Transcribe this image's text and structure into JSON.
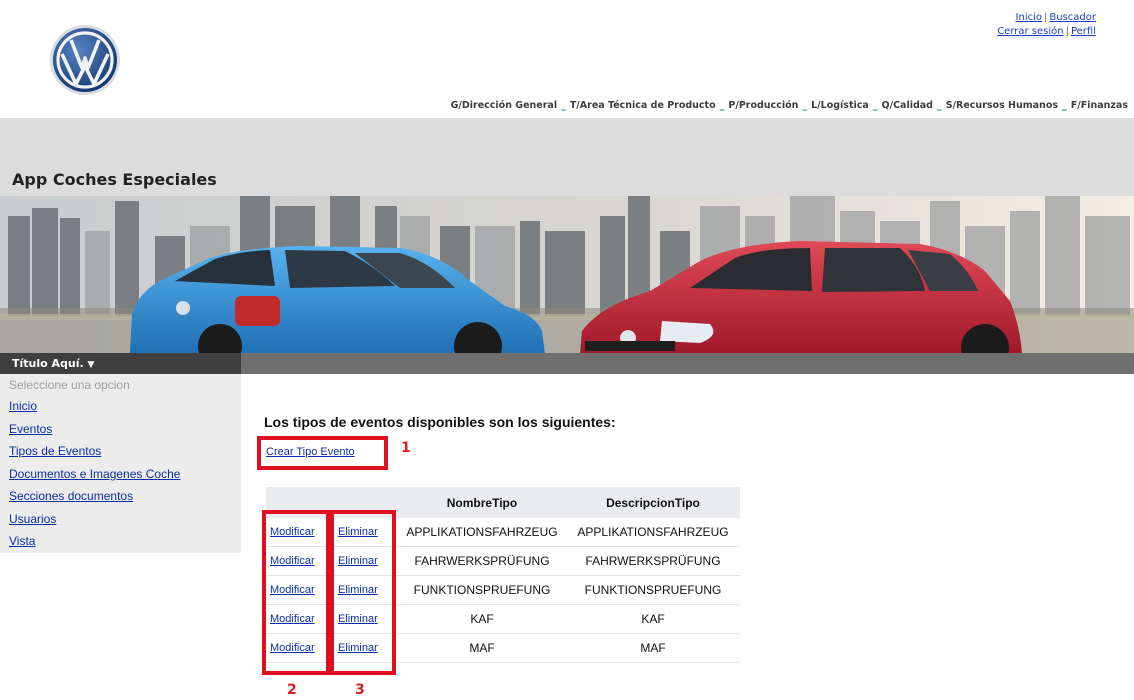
{
  "header": {
    "links_row1": [
      "Inicio",
      "Buscador"
    ],
    "links_row2": [
      "Cerrar sesión",
      "Perfil"
    ],
    "separator": "|",
    "nav": [
      "G/Dirección General",
      "T/Area Técnica de Producto",
      "P/Producción",
      "L/Logística",
      "Q/Calidad",
      "S/Recursos Humanos",
      "F/Finanzas"
    ],
    "nav_separator": "_"
  },
  "app_title": "App Coches Especiales",
  "sidebar": {
    "title": "Título Aquí.",
    "hint": "Seleccione una opcion",
    "items": [
      "Inicio",
      "Eventos",
      "Tipos de Eventos",
      "Documentos e Imagenes Coche",
      "Secciones documentos",
      "Usuarios",
      "Vista"
    ]
  },
  "main": {
    "heading": "Los tipos de eventos disponibles son los siguientes:",
    "create_link": "Crear Tipo Evento",
    "table": {
      "headers": [
        "",
        "",
        "NombreTipo",
        "DescripcionTipo"
      ],
      "modify_label": "Modificar",
      "delete_label": "Eliminar",
      "rows": [
        [
          "APPLIKATIONSFAHRZEUG",
          "APPLIKATIONSFAHRZEUG"
        ],
        [
          "FAHRWERKSPRÜFUNG",
          "FAHRWERKSPRÜFUNG"
        ],
        [
          "FUNKTIONSPRUEFUNG",
          "FUNKTIONSPRUEFUNG"
        ],
        [
          "KAF",
          "KAF"
        ],
        [
          "MAF",
          "MAF"
        ]
      ]
    }
  },
  "annotations": [
    "1",
    "2",
    "3"
  ],
  "colors": {
    "annotation_red": "#e01020",
    "link_blue": "#0b2fa6",
    "car_left": "#2f8fd8",
    "car_right": "#c8283a"
  },
  "icons": {
    "logo": "vw-logo-icon",
    "dropdown": "caret-down-icon"
  }
}
